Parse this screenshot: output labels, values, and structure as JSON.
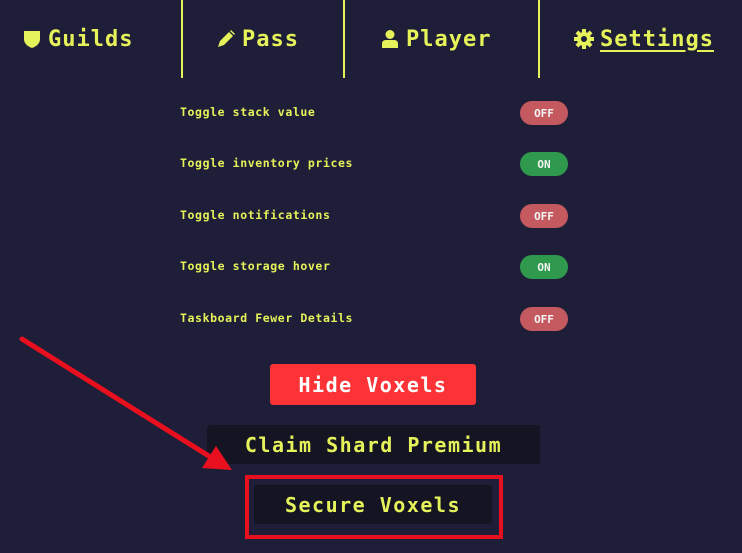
{
  "nav": {
    "items": [
      {
        "label": "Guilds",
        "icon": "shield-icon"
      },
      {
        "label": "Pass",
        "icon": "ticket-icon"
      },
      {
        "label": "Player",
        "icon": "person-icon"
      },
      {
        "label": "Settings",
        "icon": "gear-icon",
        "active": true
      }
    ]
  },
  "settings": [
    {
      "label": "Toggle stack value",
      "state": "OFF"
    },
    {
      "label": "Toggle inventory prices",
      "state": "ON"
    },
    {
      "label": "Toggle notifications",
      "state": "OFF"
    },
    {
      "label": "Toggle storage hover",
      "state": "ON"
    },
    {
      "label": "Taskboard Fewer Details",
      "state": "OFF"
    }
  ],
  "buttons": {
    "hide_voxels": "Hide Voxels",
    "claim_shard_premium": "Claim Shard Premium",
    "secure_voxels": "Secure Voxels"
  },
  "colors": {
    "background": "#1f1e38",
    "accent": "#e6f25a",
    "toggle_off": "#c45a60",
    "toggle_on": "#2f9a4e",
    "hide_button": "#fb3336",
    "dark_button": "#141422",
    "annotation": "#e8101e"
  }
}
